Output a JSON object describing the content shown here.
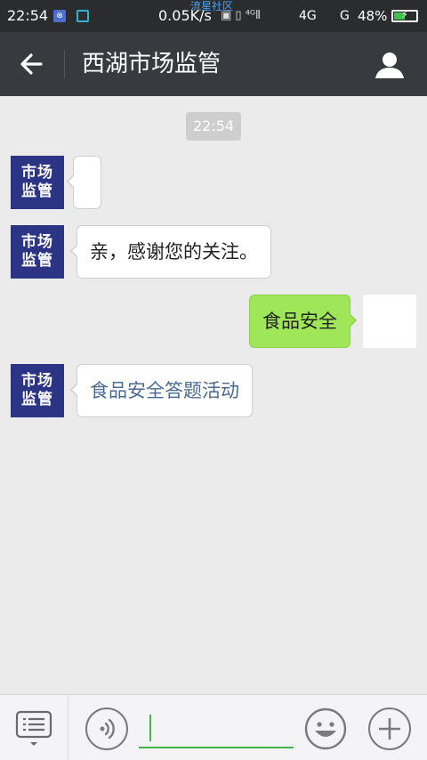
{
  "status_bar": {
    "time": "22:54",
    "app_icon_1": "lock-app-icon",
    "app_icon_2": "crop-app-icon",
    "net_speed": "0.05K/s",
    "watermark": "流星社区",
    "signal_1": "4G",
    "signal_2": "G",
    "battery": "48%"
  },
  "header": {
    "title": "西湖市场监管",
    "back_icon": "arrow-left-icon",
    "profile_icon": "person-icon"
  },
  "chat": {
    "timestamp": "22:54",
    "avatar_text_line1": "市场",
    "avatar_text_line2": "监管",
    "messages": [
      {
        "from": "official",
        "text": ""
      },
      {
        "from": "official",
        "text": "亲，感谢您的关注。"
      },
      {
        "from": "user",
        "text": "食品安全"
      },
      {
        "from": "official",
        "text": "食品安全答题活动",
        "link": true
      }
    ]
  },
  "input_bar": {
    "input_value": "",
    "menu_icon": "list-menu-icon",
    "voice_icon": "voice-icon",
    "emoji_icon": "emoji-icon",
    "plus_icon": "plus-icon"
  },
  "colors": {
    "header_bg": "#393a3f",
    "avatar_bg": "#2c3486",
    "sent_bubble": "#9fe658",
    "link_text": "#4a6a91",
    "input_accent": "#43b548"
  }
}
